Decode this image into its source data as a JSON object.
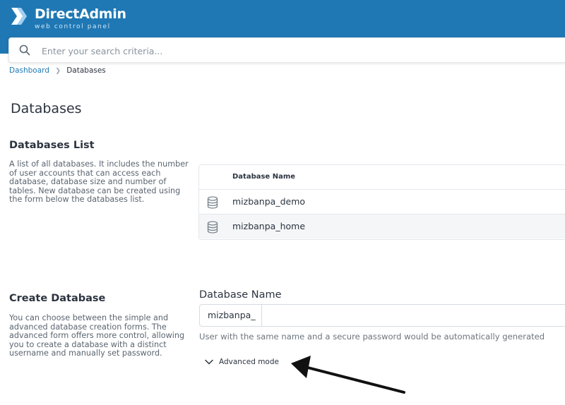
{
  "brand": {
    "title": "DirectAdmin",
    "subtitle": "web control panel",
    "color": "#1f78b4"
  },
  "search": {
    "placeholder": "Enter your search criteria..."
  },
  "breadcrumb": {
    "items": [
      "Dashboard",
      "Databases"
    ]
  },
  "page": {
    "title": "Databases"
  },
  "databases_list": {
    "title": "Databases List",
    "description": "A list of all databases. It includes the number of user accounts that can access each database, database size and number of tables. New database can be created using the form below the databases list.",
    "column_header": "Database Name",
    "rows": [
      {
        "name": "mizbanpa_demo",
        "icon": "database-icon"
      },
      {
        "name": "mizbanpa_home",
        "icon": "database-icon"
      }
    ]
  },
  "create_database": {
    "title": "Create Database",
    "description": "You can choose between the simple and advanced database creation forms. The advanced form offers more control, allowing you to create a database with a distinct username and manually set password.",
    "field_label": "Database Name",
    "prefix": "mizbanpa_",
    "value": "",
    "hint": "User with the same name and a secure password would be automatically generated",
    "advanced_label": "Advanced mode"
  }
}
